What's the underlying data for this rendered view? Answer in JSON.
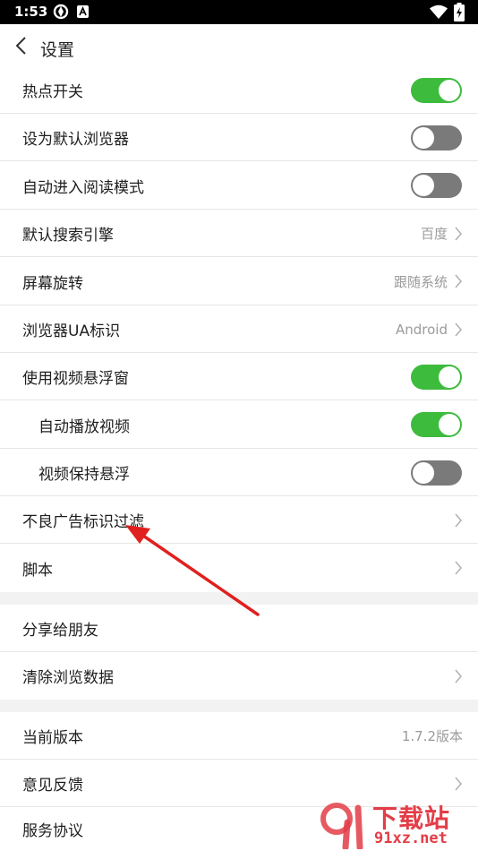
{
  "status_bar": {
    "time": "1:53"
  },
  "header": {
    "title": "设置"
  },
  "rows": {
    "hotspot": {
      "label": "热点开关",
      "on": true
    },
    "default_browser": {
      "label": "设为默认浏览器",
      "on": false
    },
    "reading_mode": {
      "label": "自动进入阅读模式",
      "on": false
    },
    "search_engine": {
      "label": "默认搜索引擎",
      "value": "百度"
    },
    "rotation": {
      "label": "屏幕旋转",
      "value": "跟随系统"
    },
    "ua": {
      "label": "浏览器UA标识",
      "value": "Android"
    },
    "video_float": {
      "label": "使用视频悬浮窗",
      "on": true
    },
    "autoplay": {
      "label": "自动播放视频",
      "on": true
    },
    "keep_float": {
      "label": "视频保持悬浮",
      "on": false
    },
    "ad_filter": {
      "label": "不良广告标识过滤"
    },
    "script": {
      "label": "脚本"
    },
    "share": {
      "label": "分享给朋友"
    },
    "clear_data": {
      "label": "清除浏览数据"
    },
    "version": {
      "label": "当前版本",
      "value": "1.7.2版本"
    },
    "feedback": {
      "label": "意见反馈"
    },
    "agreement": {
      "label": "服务协议"
    }
  },
  "watermark": {
    "cn": "下载站",
    "url": "91xz.net"
  },
  "colors": {
    "toggle_on": "#3dbb3d",
    "toggle_off": "#7a7a7a",
    "arrow": "#e0201e",
    "watermark": "#e33d47"
  },
  "icons": {
    "back": "chevron-left-icon",
    "chevron": "chevron-right-icon",
    "status": [
      "vpn-icon",
      "notification-a-icon",
      "wifi-icon",
      "battery-charging-icon"
    ]
  }
}
